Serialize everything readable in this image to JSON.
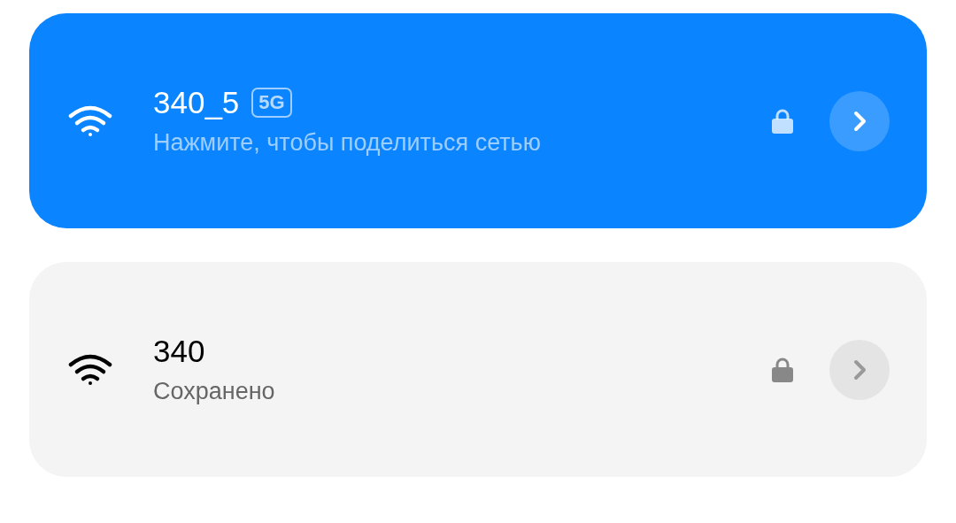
{
  "networks": [
    {
      "name": "340_5",
      "badge": "5G",
      "status": "Нажмите, чтобы поделиться сетью",
      "selected": true,
      "locked": true
    },
    {
      "name": "340",
      "status": "Сохранено",
      "selected": false,
      "locked": true
    }
  ]
}
